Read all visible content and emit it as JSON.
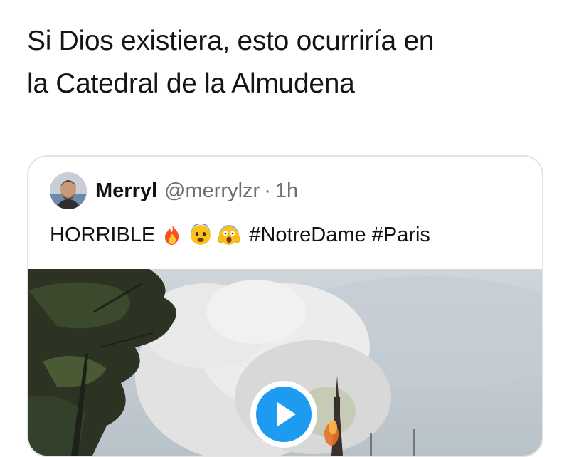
{
  "tweet": {
    "text_line1": "Si Dios existiera, esto ocurriría en",
    "text_line2": "la Catedral de la Almudena"
  },
  "quoted_tweet": {
    "author_name": "Merryl",
    "author_handle": "@merrylzr",
    "separator": "·",
    "time": "1h",
    "text_word": "HORRIBLE",
    "emojis": [
      "fire-icon",
      "anxious-face-icon",
      "screaming-face-icon"
    ],
    "hashtags": "#NotreDame #Paris",
    "media": {
      "type": "video",
      "play_icon": "play-icon"
    }
  },
  "colors": {
    "accent": "#1d9bf0",
    "text": "#141414",
    "muted": "#6e6e6e",
    "border": "#e3e3e3"
  }
}
